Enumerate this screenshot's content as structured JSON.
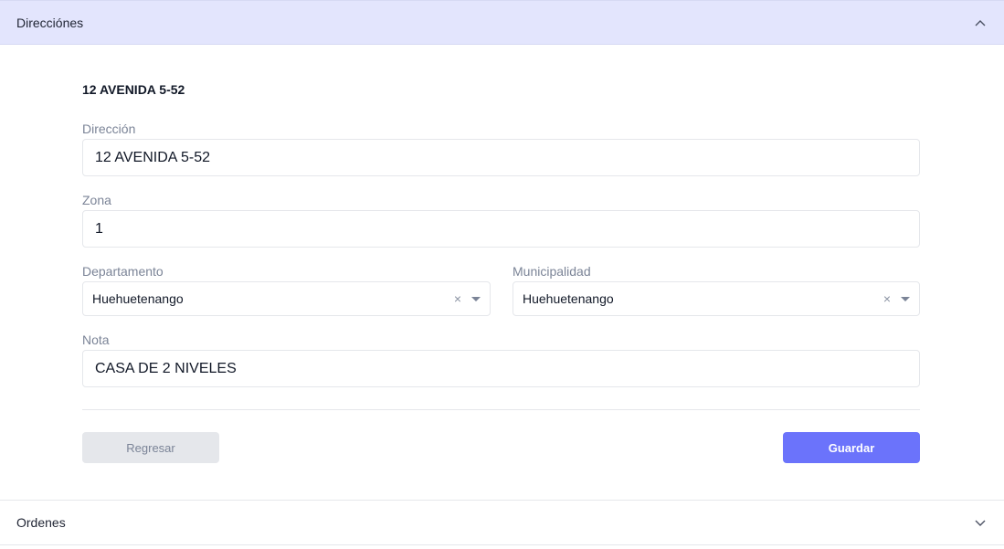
{
  "accordion": {
    "directions_label": "Direcciónes",
    "orders_label": "Ordenes"
  },
  "address_card": {
    "title": "12 AVENIDA 5-52"
  },
  "form": {
    "direccion": {
      "label": "Dirección",
      "value": "12 AVENIDA 5-52"
    },
    "zona": {
      "label": "Zona",
      "value": "1"
    },
    "departamento": {
      "label": "Departamento",
      "value": "Huehuetenango",
      "clear": "×"
    },
    "municipalidad": {
      "label": "Municipalidad",
      "value": "Huehuetenango",
      "clear": "×"
    },
    "nota": {
      "label": "Nota",
      "value": "CASA DE 2 NIVELES"
    }
  },
  "buttons": {
    "back": "Regresar",
    "save": "Guardar"
  },
  "icons": {
    "directions_chevron": "chevron-up-icon",
    "orders_chevron": "chevron-down-icon"
  },
  "colors": {
    "header_active_bg": "#e3e5fd",
    "primary": "#6b73fb",
    "secondary_bg": "#e5e7eb"
  }
}
